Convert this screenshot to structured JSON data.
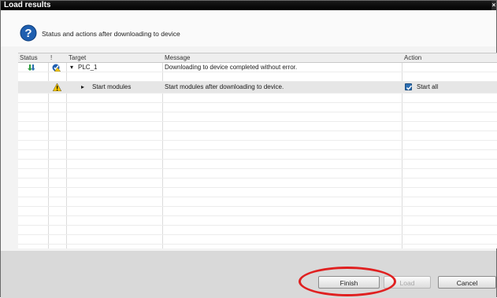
{
  "window": {
    "title": "Load results",
    "close_glyph": "×"
  },
  "header": {
    "icon": "question-icon",
    "text": "Status and actions after downloading to device"
  },
  "grid": {
    "columns": [
      "Status",
      "!",
      "Target",
      "Message",
      "Action"
    ],
    "rows": [
      {
        "status_icon": "download-arrow-icon",
        "alert_icon": "plc-warning-icon",
        "target": "PLC_1",
        "expanded": true,
        "message": "Downloading to device completed without error.",
        "action": ""
      },
      {
        "status_icon": "",
        "alert_icon": "warning-icon",
        "target": "Start modules",
        "expanded": false,
        "message": "Start modules after downloading to device.",
        "action": "Start all",
        "action_checked": true
      }
    ]
  },
  "buttons": {
    "finish": "Finish",
    "load": "Load",
    "cancel": "Cancel"
  },
  "colors": {
    "accent": "#2d6fb3",
    "highlight_ellipse": "#e02020",
    "title_bar": "#000000"
  }
}
